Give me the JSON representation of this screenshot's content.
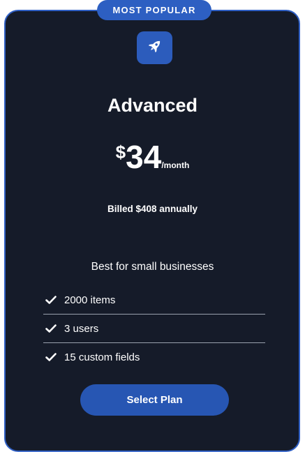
{
  "badge": {
    "label": "MOST POPULAR"
  },
  "plan": {
    "icon": "rocket-icon",
    "name": "Advanced",
    "currency": "$",
    "price": "34",
    "period": "/month",
    "billed": "Billed $408 annually",
    "description": "Best for small businesses"
  },
  "features": [
    {
      "icon": "check-icon",
      "label": "2000 items"
    },
    {
      "icon": "check-icon",
      "label": "3 users"
    },
    {
      "icon": "check-icon",
      "label": "15 custom fields"
    }
  ],
  "cta": {
    "label": "Select Plan"
  },
  "colors": {
    "card_bg": "#151b29",
    "accent": "#2d5fc2",
    "border": "#2f5fc4",
    "text": "#ffffff"
  }
}
